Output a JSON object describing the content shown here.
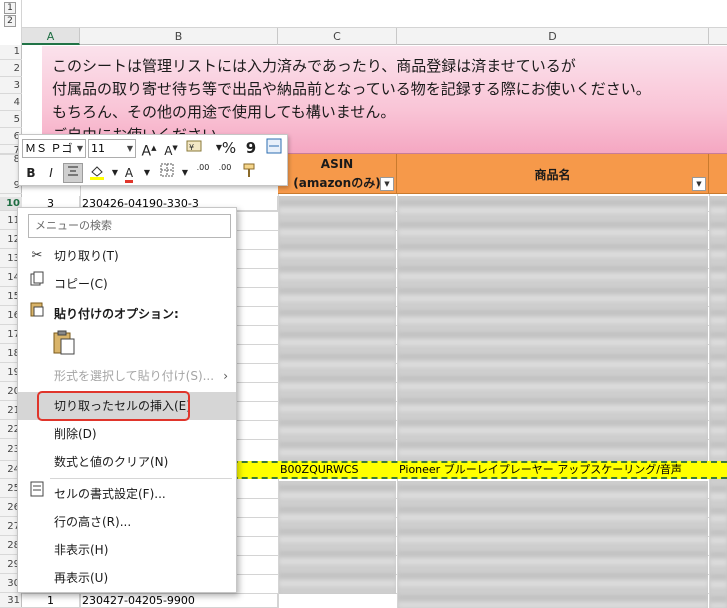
{
  "outline": {
    "levels": [
      "1",
      "2"
    ]
  },
  "columns": [
    {
      "id": "A",
      "label": "A"
    },
    {
      "id": "B",
      "label": "B"
    },
    {
      "id": "C",
      "label": "C"
    },
    {
      "id": "D",
      "label": "D"
    }
  ],
  "rows": [
    "1",
    "2",
    "3",
    "4",
    "5",
    "6",
    "7",
    "8",
    "9",
    "10",
    "11",
    "12",
    "13",
    "14",
    "15",
    "16",
    "17",
    "18",
    "19",
    "20",
    "21",
    "22",
    "23",
    "24",
    "25",
    "26",
    "27",
    "28",
    "29",
    "30",
    "31"
  ],
  "banner": {
    "lines": [
      "このシートは管理リストには入力済みであったり、商品登録は済ませているが",
      "付属品の取り寄せ待ち等で出品や納品前となっている物を記録する際にお使いください。",
      "もちろん、その他の用途で使用しても構いません。",
      "ご自由にお使いください。"
    ]
  },
  "table_headers": {
    "asin_line1": "ASIN",
    "asin_line2": "(amazonのみ)",
    "name": "商品名"
  },
  "cells": {
    "row10_a": "3",
    "row10_b": "230426-04190-330-3",
    "row24_c": "B00ZQURWCS",
    "row24_d": "Pioneer ブルーレイプレーヤー アップスケーリング/音声",
    "row31_a": "1",
    "row31_b": "230427-04205-9900"
  },
  "mini_toolbar": {
    "font_name": "ＭＳ Ｐゴ",
    "font_size": "11",
    "grow_font": "A",
    "shrink_font": "A",
    "format_icon": "format-icon",
    "percent": "%",
    "comma": "9",
    "bold": "B",
    "italic": "I",
    "font_color_letter": "A",
    "dec_inc": ".00",
    "dec_dec": ".00"
  },
  "context_menu": {
    "search_placeholder": "メニューの検索",
    "items": [
      {
        "label": "切り取り(T)",
        "icon": "scissors-icon"
      },
      {
        "label": "コピー(C)",
        "icon": "copy-icon"
      },
      {
        "label": "貼り付けのオプション:",
        "icon": "paste-icon"
      },
      {
        "label": "形式を選択して貼り付け(S)...",
        "icon": ""
      },
      {
        "label": "切り取ったセルの挿入(E)",
        "icon": ""
      },
      {
        "label": "削除(D)",
        "icon": ""
      },
      {
        "label": "数式と値のクリア(N)",
        "icon": ""
      },
      {
        "label": "セルの書式設定(F)...",
        "icon": "format-cells-icon"
      },
      {
        "label": "行の高さ(R)...",
        "icon": ""
      },
      {
        "label": "非表示(H)",
        "icon": ""
      },
      {
        "label": "再表示(U)",
        "icon": ""
      }
    ]
  },
  "colors": {
    "accent_green": "#217346",
    "header_orange": "#f6994a",
    "highlight_yellow": "#ffff00",
    "annotation_red": "#e0352b"
  }
}
